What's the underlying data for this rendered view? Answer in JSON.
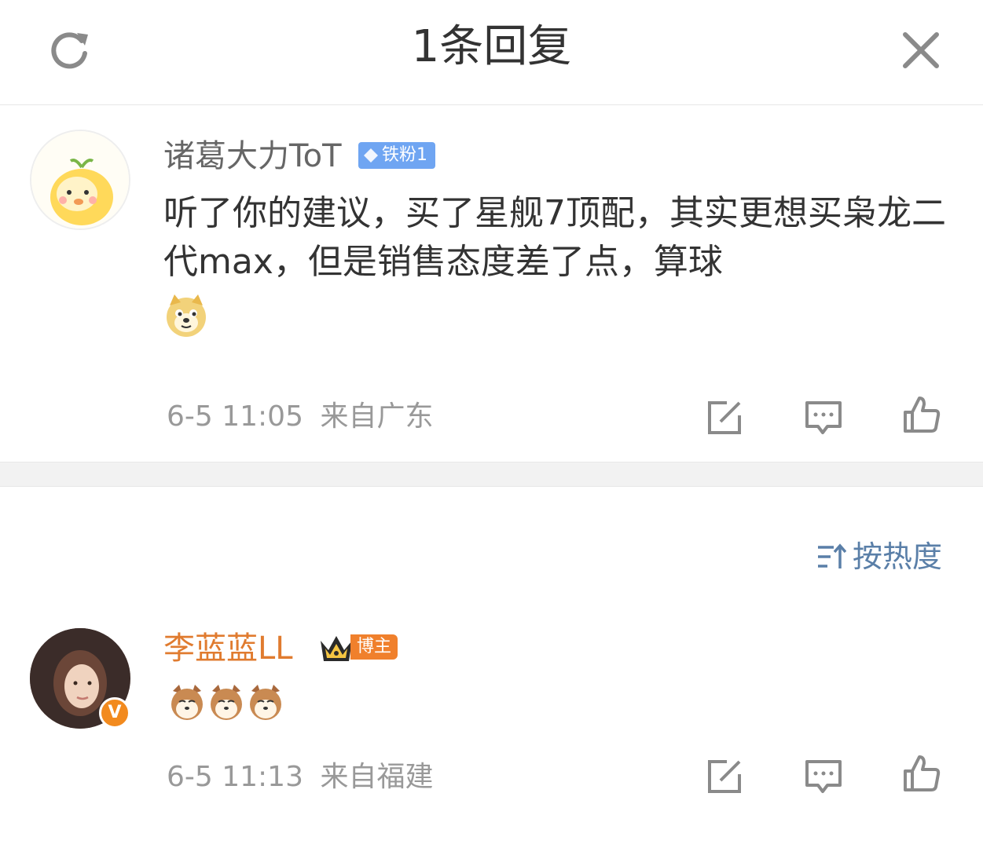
{
  "header": {
    "title": "1条回复"
  },
  "comment_main": {
    "username": "诸葛大力ToT",
    "badge": "铁粉1",
    "text": "听了你的建议，买了星舰7顶配，其实更想买枭龙二代max，但是销售态度差了点，算球",
    "time": "6-5 11:05",
    "location": "来自广东"
  },
  "sort": {
    "label": "按热度"
  },
  "reply": {
    "username": "李蓝蓝LL",
    "badge": "博主",
    "vip_mark": "V",
    "time": "6-5 11:13",
    "location": "来自福建"
  },
  "colors": {
    "accent_link": "#5a7fa8",
    "author_orange": "#e07b2f",
    "iron_badge": "#6fa5f2"
  },
  "icons": [
    "refresh-icon",
    "close-icon",
    "share-icon",
    "comment-icon",
    "like-icon",
    "sort-icon",
    "crown-icon"
  ]
}
